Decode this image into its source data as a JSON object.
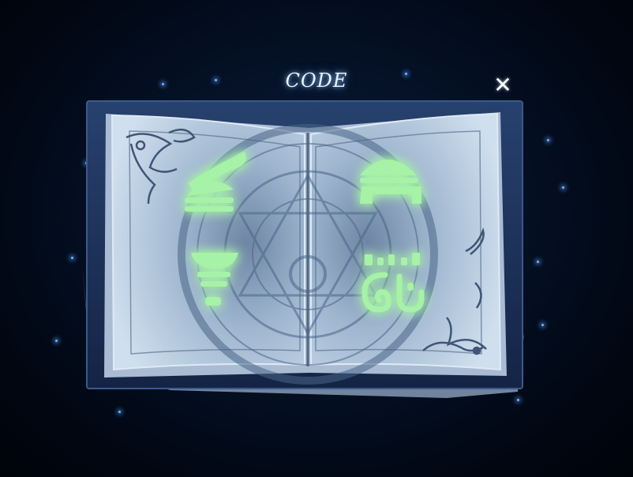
{
  "screen": {
    "title": "CODE",
    "close_symbol": "✕"
  },
  "code_glyphs": [
    {
      "page": "left",
      "row": 1,
      "icon": "wave-dome-rune"
    },
    {
      "page": "right",
      "row": 1,
      "icon": "dome-bracket-rune"
    },
    {
      "page": "left",
      "row": 2,
      "icon": "bowl-bars-dot-rune"
    },
    {
      "page": "right",
      "row": 2,
      "icon": "bars-curls-rune"
    }
  ],
  "colors": {
    "background": "#02081a",
    "page": "#bcd0e6",
    "cover": "#1c2f55",
    "glyph": "#a6f2a6",
    "glow": "#58c8ff",
    "title": "#e8f2ff"
  }
}
